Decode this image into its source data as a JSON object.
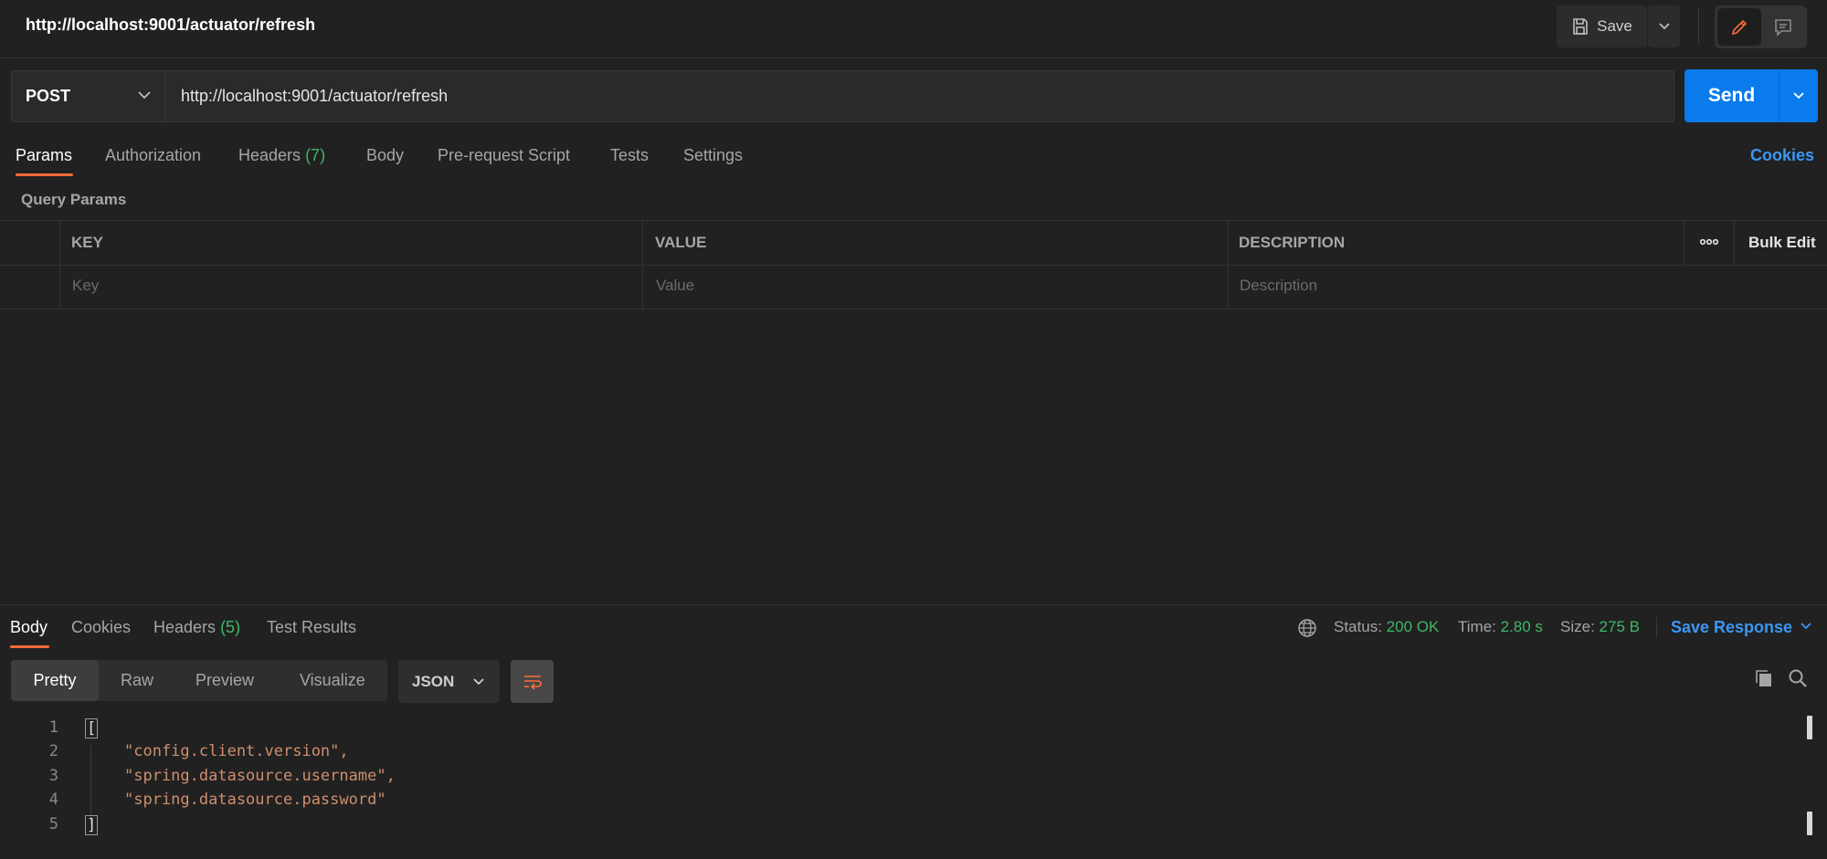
{
  "header": {
    "title": "http://localhost:9001/actuator/refresh",
    "save_label": "Save"
  },
  "request": {
    "method": "POST",
    "url": "http://localhost:9001/actuator/refresh",
    "send_label": "Send"
  },
  "request_tabs": {
    "params": "Params",
    "authorization": "Authorization",
    "headers": "Headers",
    "headers_count": "(7)",
    "body": "Body",
    "pre_request": "Pre-request Script",
    "tests": "Tests",
    "settings": "Settings",
    "cookies": "Cookies"
  },
  "query_params": {
    "title": "Query Params",
    "columns": {
      "key": "KEY",
      "value": "VALUE",
      "description": "DESCRIPTION"
    },
    "bulk_edit": "Bulk Edit",
    "placeholders": {
      "key": "Key",
      "value": "Value",
      "description": "Description"
    }
  },
  "response": {
    "tabs": {
      "body": "Body",
      "cookies": "Cookies",
      "headers": "Headers",
      "headers_count": "(5)",
      "test_results": "Test Results"
    },
    "status_label": "Status:",
    "status_value": "200 OK",
    "time_label": "Time:",
    "time_value": "2.80 s",
    "size_label": "Size:",
    "size_value": "275 B",
    "save_response": "Save Response",
    "view_tabs": {
      "pretty": "Pretty",
      "raw": "Raw",
      "preview": "Preview",
      "visualize": "Visualize"
    },
    "language": "JSON",
    "lines": {
      "n1": "1",
      "n2": "2",
      "n3": "3",
      "n4": "4",
      "n5": "5",
      "open": "[",
      "l2": "\"config.client.version\",",
      "l3": "\"spring.datasource.username\",",
      "l4": "\"spring.datasource.password\"",
      "close": "]"
    }
  },
  "colors": {
    "background": "#212121",
    "accent_orange": "#ff6c37",
    "send_blue": "#097bed",
    "link_blue": "#3b97f5",
    "status_green": "#3fb868",
    "json_string": "#ce8f6d"
  },
  "icons": [
    "save-icon",
    "chevron-down-icon",
    "pencil-icon",
    "comment-icon",
    "more-horizontal-icon",
    "globe-icon",
    "wrap-lines-icon",
    "copy-icon",
    "search-icon"
  ]
}
